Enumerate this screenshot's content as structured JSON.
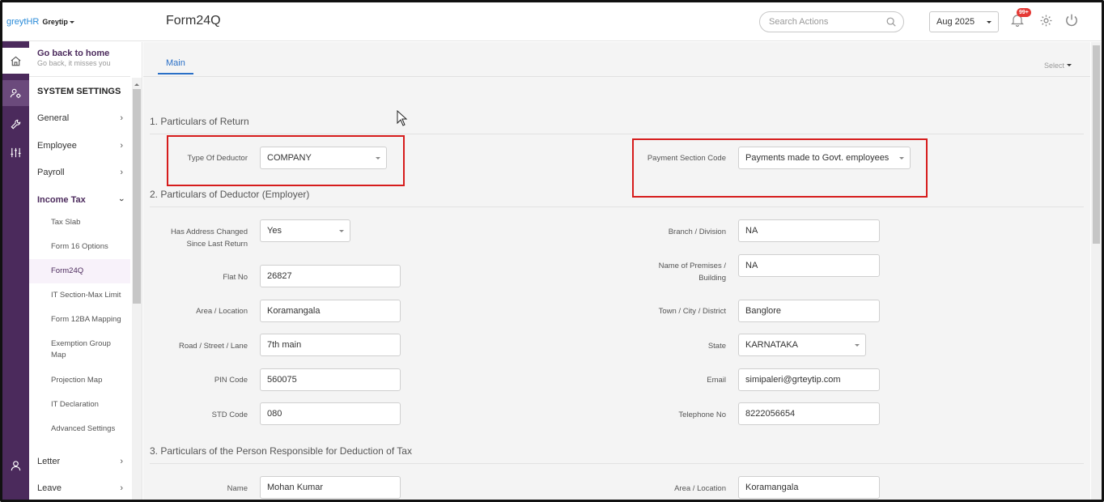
{
  "brand": {
    "logo": "greytHR",
    "company": "Greytip"
  },
  "header": {
    "title": "Form24Q",
    "search_placeholder": "Search Actions",
    "month": "Aug 2025",
    "notif_badge": "99+"
  },
  "sidebar": {
    "home_title": "Go back to home",
    "home_sub": "Go back, it misses you",
    "section": "SYSTEM SETTINGS",
    "items": [
      {
        "label": "General"
      },
      {
        "label": "Employee"
      },
      {
        "label": "Payroll"
      },
      {
        "label": "Income Tax"
      },
      {
        "label": "Letter"
      },
      {
        "label": "Leave"
      }
    ],
    "sub_items": [
      {
        "label": "Tax Slab"
      },
      {
        "label": "Form 16 Options"
      },
      {
        "label": "Form24Q"
      },
      {
        "label": "IT Section-Max Limit"
      },
      {
        "label": "Form 12BA Mapping"
      },
      {
        "label": "Exemption Group Map"
      },
      {
        "label": "Projection Map"
      },
      {
        "label": "IT Declaration"
      },
      {
        "label": "Advanced Settings"
      }
    ]
  },
  "tabs": {
    "main": "Main",
    "select": "Select"
  },
  "form": {
    "sec1": "1. Particulars of Return",
    "sec2": "2. Particulars of Deductor (Employer)",
    "sec3": "3. Particulars of the Person Responsible for Deduction of Tax",
    "type_of_deductor": {
      "label": "Type Of Deductor",
      "value": "COMPANY"
    },
    "payment_section_code": {
      "label": "Payment Section Code",
      "value": "Payments made to Govt. employees"
    },
    "address_changed": {
      "label": "Has Address Changed Since Last Return",
      "value": "Yes"
    },
    "flat_no": {
      "label": "Flat No",
      "value": "26827"
    },
    "area": {
      "label": "Area / Location",
      "value": "Koramangala"
    },
    "road": {
      "label": "Road / Street / Lane",
      "value": "7th main"
    },
    "pin": {
      "label": "PIN Code",
      "value": "560075"
    },
    "std": {
      "label": "STD Code",
      "value": "080"
    },
    "branch": {
      "label": "Branch / Division",
      "value": "NA"
    },
    "premises": {
      "label": "Name of Premises / Building",
      "value": "NA"
    },
    "town": {
      "label": "Town / City / District",
      "value": "Banglore"
    },
    "state": {
      "label": "State",
      "value": "KARNATAKA"
    },
    "email": {
      "label": "Email",
      "value": "simipaleri@grteytip.com"
    },
    "telephone": {
      "label": "Telephone No",
      "value": "8222056654"
    },
    "person_name": {
      "label": "Name",
      "value": "Mohan Kumar"
    },
    "person_area": {
      "label": "Area / Location",
      "value": "Koramangala"
    }
  },
  "colors": {
    "rail": "#4b2a5c",
    "accent": "#2a70c7",
    "highlight": "#d61c1c"
  }
}
